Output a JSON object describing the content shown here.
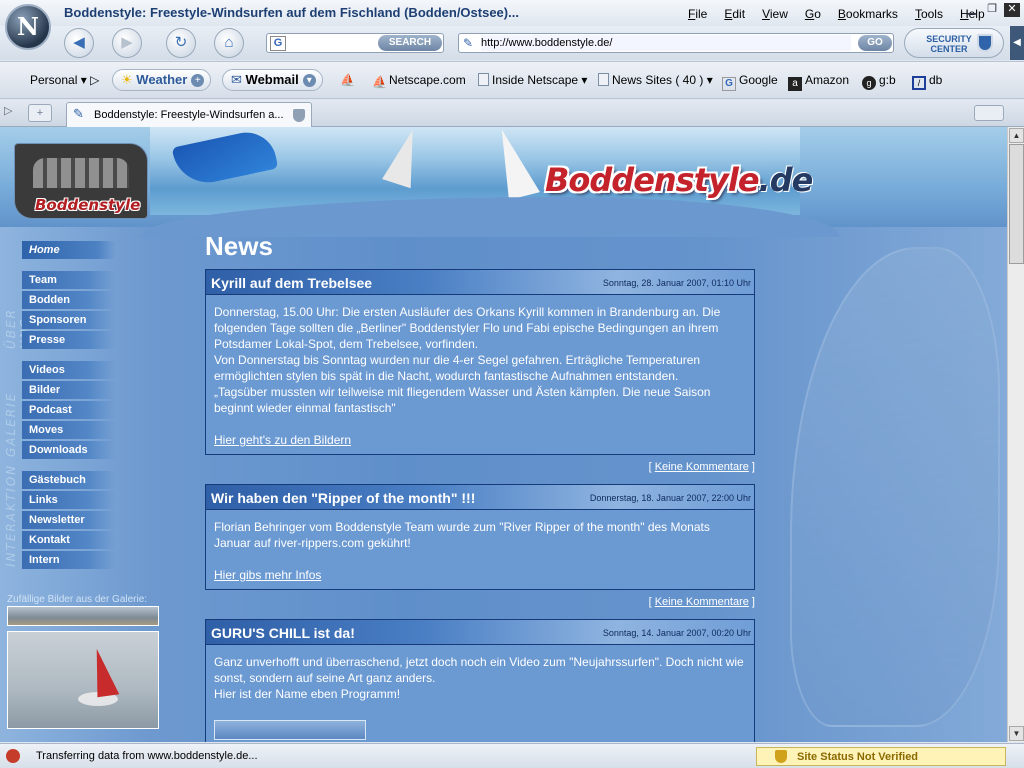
{
  "window": {
    "title": "Boddenstyle: Freestyle-Windsurfen auf dem Fischland (Bodden/Ostsee)...",
    "browser_logo": "N"
  },
  "menu": [
    "File",
    "Edit",
    "View",
    "Go",
    "Bookmarks",
    "Tools",
    "Help"
  ],
  "toolbar": {
    "search_label": "SEARCH",
    "url": "http://www.boddenstyle.de/",
    "go_label": "GO",
    "security_center": "SECURITY CENTER"
  },
  "personal_toolbar": {
    "personal": "Personal",
    "weather": "Weather",
    "webmail": "Webmail",
    "bookmarks": [
      "Netscape.com",
      "Inside Netscape",
      "News Sites ( 40 )",
      "Google",
      "Amazon",
      "g:b",
      "db"
    ]
  },
  "tab": {
    "label": "Boddenstyle: Freestyle-Windsurfen a..."
  },
  "banner": {
    "logo_text": "Boddenstyle",
    "title_main": "Boddenstyle",
    "title_suffix": ".de"
  },
  "nav": {
    "home": "Home",
    "labels": {
      "about": "ÜBER UNS",
      "gallery": "GALERIE",
      "interaction": "INTERAKTION"
    },
    "about": [
      "Team",
      "Bodden",
      "Sponsoren",
      "Presse"
    ],
    "gallery": [
      "Videos",
      "Bilder",
      "Podcast",
      "Moves",
      "Downloads"
    ],
    "interaction": [
      "Gästebuch",
      "Links",
      "Newsletter",
      "Kontakt",
      "Intern"
    ],
    "gallery_caption": "Zufällige Bilder aus der Galerie:"
  },
  "main": {
    "heading": "News",
    "posts": [
      {
        "title": "Kyrill auf dem Trebelsee",
        "date": "Sonntag, 28. Januar 2007, 01:10 Uhr",
        "p1": "Donnerstag, 15.00 Uhr: Die ersten Ausläufer des Orkans Kyrill kommen in Brandenburg an. Die folgenden Tage sollten die „Berliner\" Boddenstyler Flo und Fabi epische Bedingungen an ihrem Potsdamer Lokal-Spot, dem Trebelsee, vorfinden.",
        "p2": "Von Donnerstag bis Sonntag wurden nur die 4-er Segel gefahren. Erträgliche Temperaturen ermöglichten stylen bis spät in die Nacht, wodurch fantastische Aufnahmen entstanden.",
        "p3": "„Tagsüber mussten wir teilweise mit fliegendem Wasser und Ästen kämpfen. Die neue Saison beginnt wieder einmal fantastisch\"",
        "link": "Hier geht's zu den Bildern",
        "comments": "Keine Kommentare"
      },
      {
        "title": "Wir haben den \"Ripper of the month\" !!!",
        "date": "Donnerstag, 18. Januar 2007, 22:00 Uhr",
        "p1": "Florian Behringer vom Boddenstyle Team wurde zum \"River Ripper of the month\" des Monats Januar auf river-rippers.com gekührt!",
        "link": "Hier gibs mehr Infos",
        "comments": "Keine Kommentare"
      },
      {
        "title": "GURU'S CHILL ist da!",
        "date": "Sonntag, 14. Januar 2007, 00:20 Uhr",
        "p1": "Ganz unverhofft und überraschend, jetzt doch noch ein Video zum \"Neujahrssurfen\". Doch nicht wie sonst, sondern auf seine Art ganz anders.",
        "p2": "Hier ist der Name eben Programm!"
      }
    ]
  },
  "status": {
    "text": "Transferring data from www.boddenstyle.de...",
    "site_status": "Site Status Not Verified"
  },
  "icons": {
    "back": "back-arrow-icon",
    "forward": "forward-arrow-icon",
    "reload": "reload-icon",
    "home": "home-icon",
    "security": "shield-icon"
  },
  "colors": {
    "page_bg": "#6593cc",
    "post_head": "#2f5fa7",
    "brand_red": "#c4232c"
  }
}
